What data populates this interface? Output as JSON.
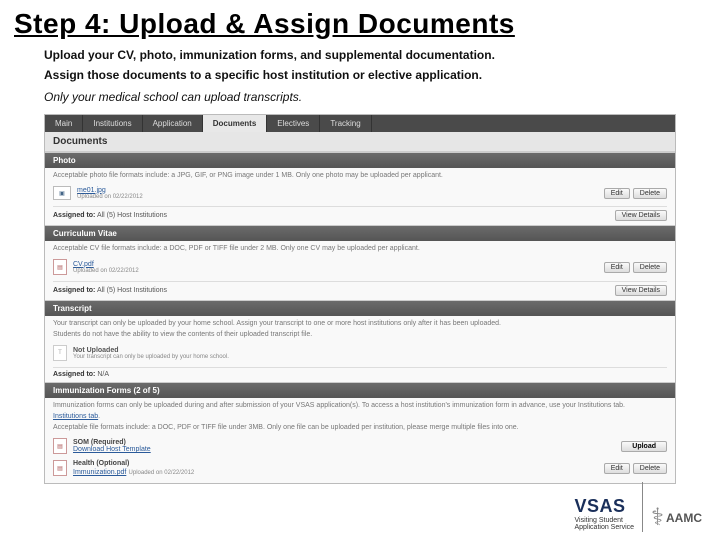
{
  "title": "Step 4: Upload & Assign Documents",
  "intro_line1": "Upload your CV, photo, immunization forms, and supplemental documentation.",
  "intro_line2": "Assign those documents to a specific host institution or elective application.",
  "intro_note": "Only your medical school can upload transcripts.",
  "tabs": {
    "main": "Main",
    "institutions": "Institutions",
    "application": "Application",
    "documents": "Documents",
    "electives": "Electives",
    "tracking": "Tracking"
  },
  "page_header": "Documents",
  "buttons": {
    "edit": "Edit",
    "delete": "Delete",
    "view": "View Details",
    "upload": "Upload"
  },
  "photo": {
    "header": "Photo",
    "note": "Acceptable photo file formats include: a JPG, GIF, or PNG image under 1 MB. Only one photo may be uploaded per applicant.",
    "fname": "me01.jpg",
    "fmeta": "Uploaded on 02/22/2012",
    "assigned_label": "Assigned to:",
    "assigned_value": "All (5) Host Institutions"
  },
  "cv": {
    "header": "Curriculum Vitae",
    "note": "Acceptable CV file formats include: a DOC, PDF or TIFF file under 2 MB. Only one CV may be uploaded per applicant.",
    "fname": "CV.pdf",
    "fmeta": "Uploaded on 02/22/2012",
    "assigned_label": "Assigned to:",
    "assigned_value": "All (5) Host Institutions"
  },
  "transcript": {
    "header": "Transcript",
    "note1": "Your transcript can only be uploaded by your home school. Assign your transcript to one or more host institutions only after it has been uploaded.",
    "note2": "Students do not have the ability to view the contents of their uploaded transcript file.",
    "status": "Not Uploaded",
    "status_sub": "Your transcript can only be uploaded by your home school.",
    "assigned_label": "Assigned to:",
    "assigned_value": "N/A"
  },
  "immun": {
    "header": "Immunization Forms (2 of 5)",
    "note1": "Immunization forms can only be uploaded during and after submission of your VSAS application(s). To access a host institution's immunization form in advance, use your Institutions tab.",
    "note2": "Acceptable file formats include: a DOC, PDF or TIFF file under 3MB. Only one file can be uploaded per institution, please merge multiple files into one.",
    "link_tab": "Institutions tab",
    "row1_name": "SOM (Required)",
    "row1_link": "Download Host Template",
    "row2_name": "Health (Optional)",
    "row2_link": "Immunization.pdf",
    "row2_meta": "Uploaded on 02/22/2012"
  },
  "branding": {
    "vsas": "VSAS",
    "vsas_sub1": "Visiting Student",
    "vsas_sub2": "Application Service",
    "aamc": "AAMC"
  }
}
